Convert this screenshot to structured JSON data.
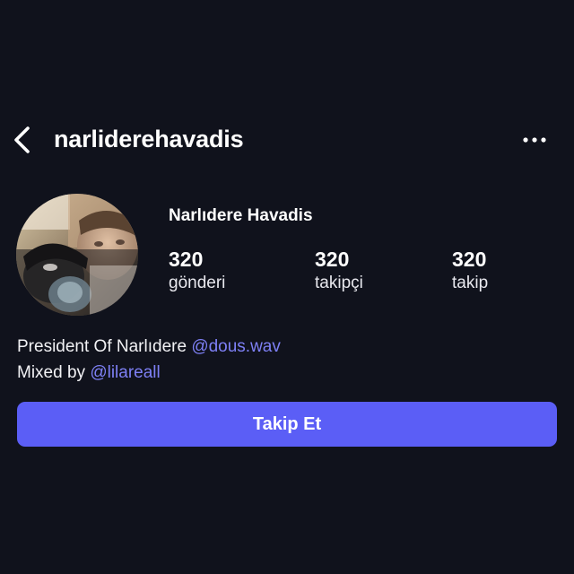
{
  "header": {
    "username": "narliderehavadis",
    "back_icon": "chevron-left-icon",
    "more_icon": "more-horizontal-icon"
  },
  "profile": {
    "display_name": "Narlıdere Havadis",
    "avatar": "profile-photo"
  },
  "stats": [
    {
      "value": "320",
      "label": "gönderi"
    },
    {
      "value": "320",
      "label": "takipçi"
    },
    {
      "value": "320",
      "label": "takip"
    }
  ],
  "bio": {
    "line1_text": "President Of Narlıdere ",
    "line1_mention": "@dous.wav",
    "line2_text": "Mixed by ",
    "line2_mention": "@lilareall"
  },
  "actions": {
    "follow_label": "Takip Et"
  },
  "colors": {
    "background": "#10121c",
    "accent": "#5b5ef6",
    "mention": "#7e80f5",
    "text": "#ffffff"
  }
}
